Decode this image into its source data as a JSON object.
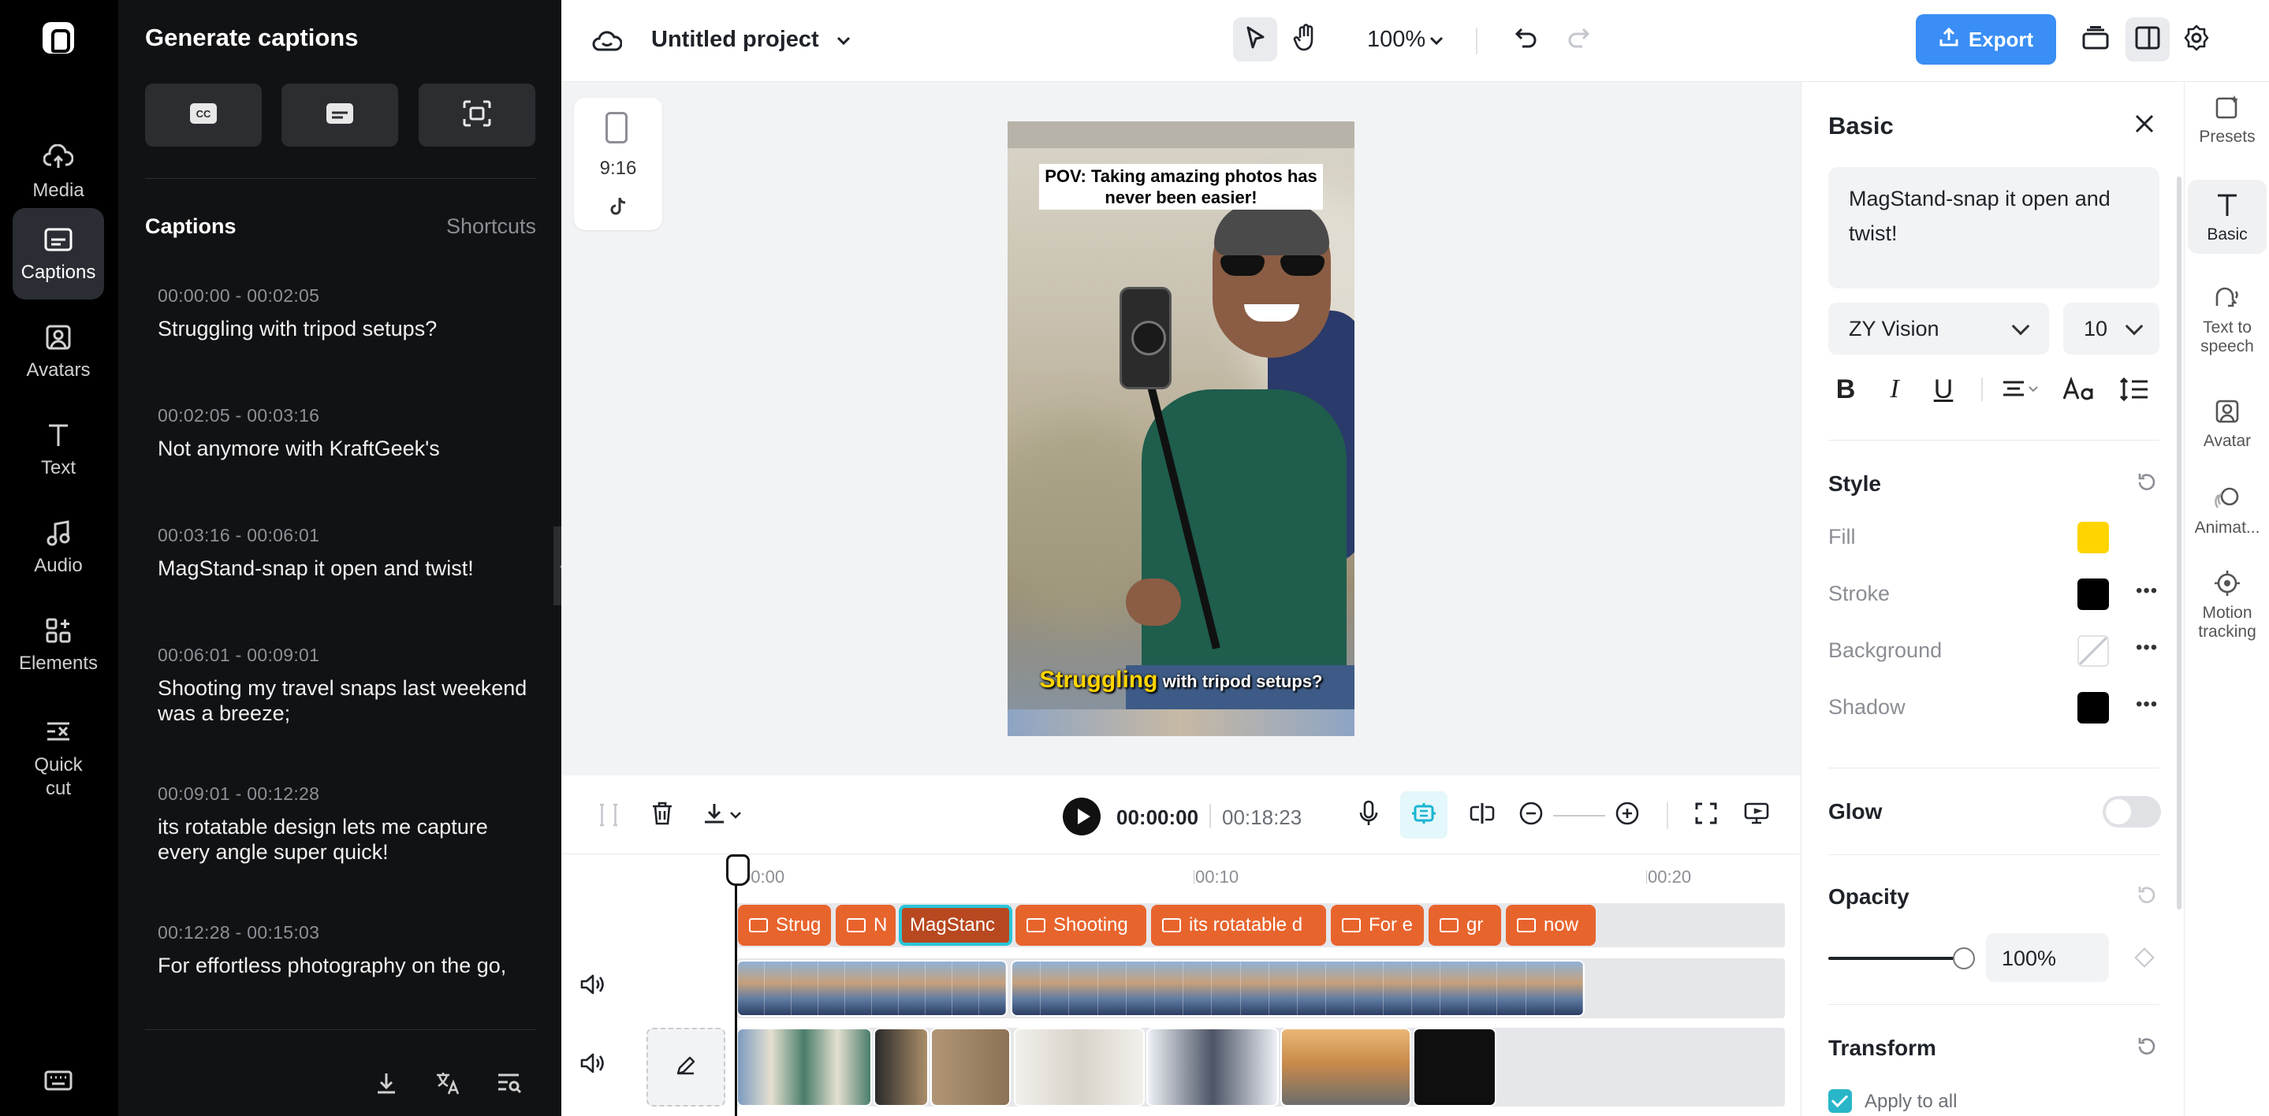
{
  "rail": {
    "items": [
      {
        "label": "Media",
        "icon": "cloud-upload-icon"
      },
      {
        "label": "Captions",
        "icon": "captions-icon",
        "active": true
      },
      {
        "label": "Avatars",
        "icon": "avatar-icon"
      },
      {
        "label": "Text",
        "icon": "text-icon"
      },
      {
        "label": "Audio",
        "icon": "music-note-icon"
      },
      {
        "label": "Elements",
        "icon": "elements-icon"
      },
      {
        "label": "Quick cut",
        "icon": "quick-cut-icon"
      }
    ]
  },
  "captions_panel": {
    "title": "Generate captions",
    "section_title": "Captions",
    "shortcuts_label": "Shortcuts",
    "items": [
      {
        "time": "00:00:00 - 00:02:05",
        "text": "Struggling with tripod setups?"
      },
      {
        "time": "00:02:05 - 00:03:16",
        "text": "Not anymore with KraftGeek's"
      },
      {
        "time": "00:03:16 - 00:06:01",
        "text": "MagStand-snap it open and twist!"
      },
      {
        "time": "00:06:01 - 00:09:01",
        "text": "Shooting my travel snaps last weekend was a breeze;"
      },
      {
        "time": "00:09:01 - 00:12:28",
        "text": "its rotatable design lets me capture every angle super quick!"
      },
      {
        "time": "00:12:28 - 00:15:03",
        "text": "For effortless photography on the go,"
      }
    ]
  },
  "topbar": {
    "project_title": "Untitled project",
    "zoom": "100%",
    "export_label": "Export"
  },
  "canvas": {
    "ratio_label": "9:16",
    "caption_top": "POV: Taking amazing photos has never been easier!",
    "caption_bottom_highlight": "Struggling",
    "caption_bottom_rest": "with tripod setups?"
  },
  "playback": {
    "current_time": "00:00:00",
    "total_time": "00:18:23"
  },
  "timeline": {
    "ruler": [
      "00:00",
      "00:10",
      "00:20"
    ],
    "caption_clips": [
      "Strug",
      "N",
      "MagStanc",
      "Shooting",
      "its rotatable d",
      "For e",
      "gr",
      "now"
    ]
  },
  "props": {
    "title": "Basic",
    "text_value": "MagStand-snap it open and twist!",
    "font": "ZY Vision",
    "size": "10",
    "style_title": "Style",
    "fill_label": "Fill",
    "stroke_label": "Stroke",
    "background_label": "Background",
    "shadow_label": "Shadow",
    "glow_label": "Glow",
    "opacity_title": "Opacity",
    "opacity_value": "100%",
    "opacity_level": 1.0,
    "transform_title": "Transform",
    "apply_all_label": "Apply to all",
    "colors": {
      "fill": "#FFD400",
      "stroke": "#000000",
      "shadow": "#000000"
    }
  },
  "right_tabs": [
    {
      "label": "Presets",
      "icon": "presets-icon"
    },
    {
      "label": "Basic",
      "icon": "text-t-icon",
      "active": true
    },
    {
      "label": "Text to speech",
      "icon": "text-to-speech-icon"
    },
    {
      "label": "Avatar",
      "icon": "avatar-icon"
    },
    {
      "label": "Animat...",
      "icon": "animation-icon"
    },
    {
      "label": "Motion tracking",
      "icon": "motion-tracking-icon"
    }
  ]
}
